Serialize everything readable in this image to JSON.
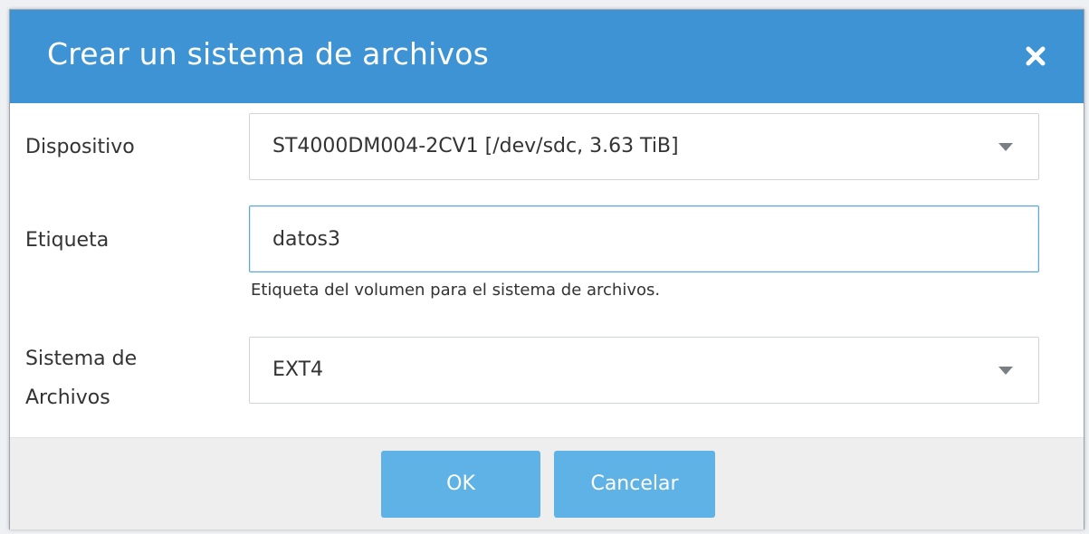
{
  "dialog": {
    "title": "Crear un sistema de archivos",
    "close_icon": "close-icon"
  },
  "form": {
    "device": {
      "label": "Dispositivo",
      "value": "ST4000DM004-2CV1 [/dev/sdc, 3.63 TiB]"
    },
    "label_field": {
      "label": "Etiqueta",
      "value": "datos3",
      "help": "Etiqueta del volumen para el sistema de archivos."
    },
    "filesystem": {
      "label_line1": "Sistema de",
      "label_line2": "Archivos",
      "value": "EXT4"
    }
  },
  "footer": {
    "ok_label": "OK",
    "cancel_label": "Cancelar"
  },
  "colors": {
    "titlebar": "#3d93d3",
    "button": "#5fb2e6",
    "focus_border": "#5aa6dd"
  }
}
